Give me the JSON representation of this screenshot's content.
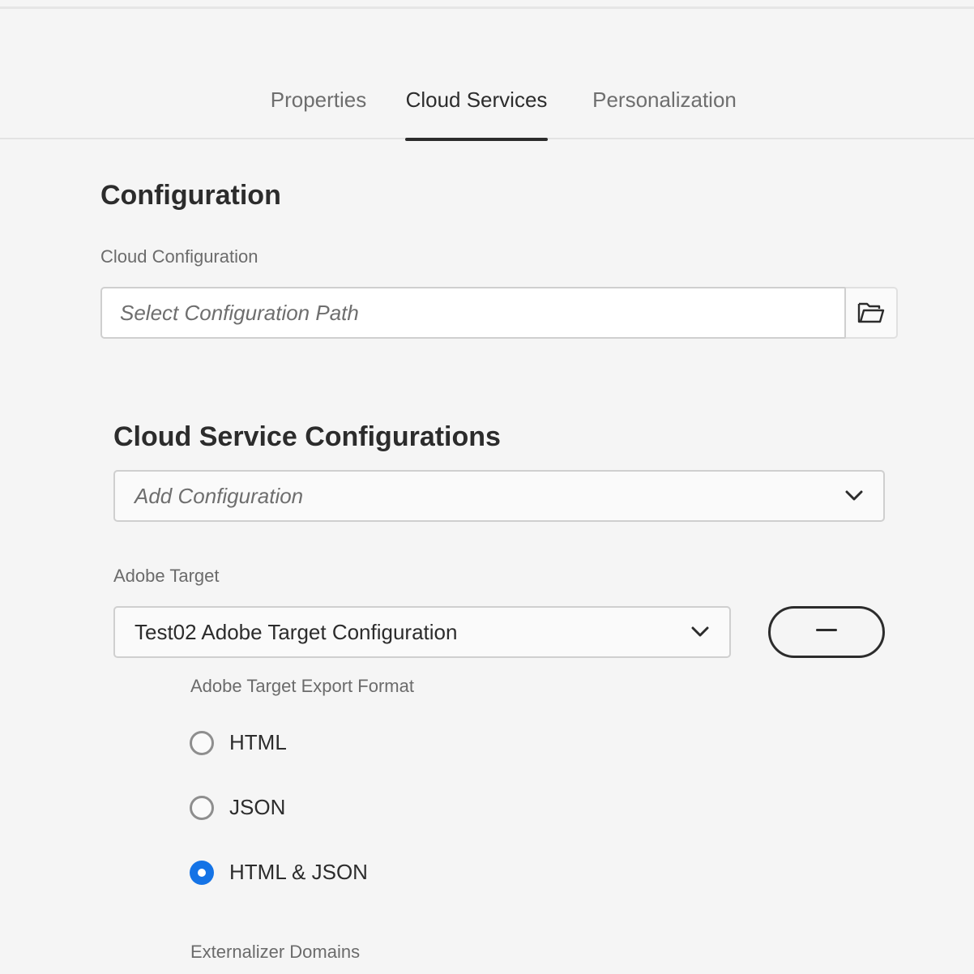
{
  "tabs": [
    {
      "label": "Properties",
      "active": false
    },
    {
      "label": "Cloud Services",
      "active": true
    },
    {
      "label": "Personalization",
      "active": false
    }
  ],
  "configuration": {
    "heading": "Configuration",
    "cloud_config_label": "Cloud Configuration",
    "path_placeholder": "Select Configuration Path",
    "path_value": "",
    "browse_icon": "folder-open-icon"
  },
  "cloud_service_configurations": {
    "heading": "Cloud Service Configurations",
    "add_config_placeholder": "Add Configuration",
    "adobe_target": {
      "label": "Adobe Target",
      "selected": "Test02 Adobe Target Configuration",
      "remove_icon": "minus-icon",
      "export_format_label": "Adobe Target Export Format",
      "export_options": [
        {
          "label": "HTML",
          "checked": false
        },
        {
          "label": "JSON",
          "checked": false
        },
        {
          "label": "HTML & JSON",
          "checked": true
        }
      ]
    },
    "externalizer_domains_label": "Externalizer Domains"
  },
  "colors": {
    "accent": "#1473e6",
    "text": "#2c2c2c",
    "muted": "#6e6e6e",
    "background": "#f5f5f5"
  }
}
